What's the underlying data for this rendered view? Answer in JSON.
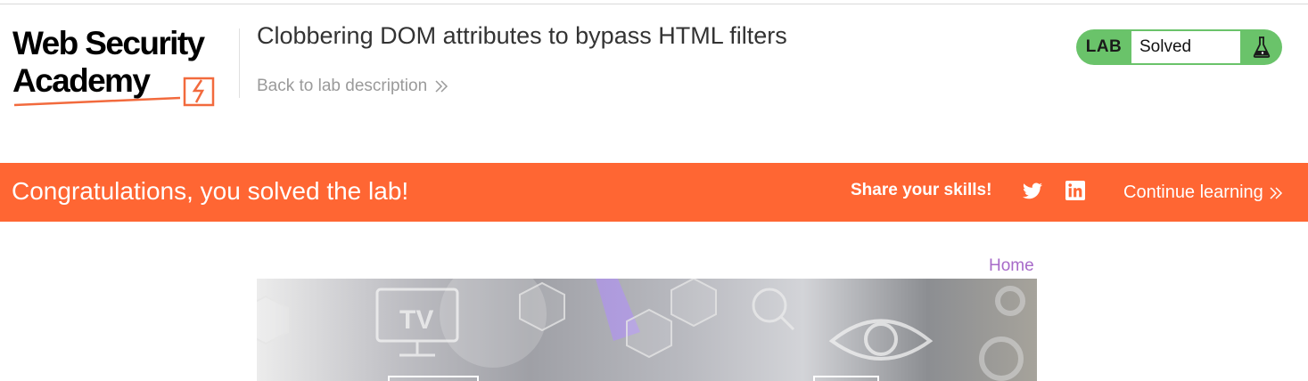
{
  "header": {
    "logo": {
      "line1": "Web Security",
      "line2": "Academy"
    },
    "lab_title": "Clobbering DOM attributes to bypass HTML filters",
    "back_link": "Back to lab description",
    "status": {
      "tag": "LAB",
      "value": "Solved"
    }
  },
  "banner": {
    "message": "Congratulations, you solved the lab!",
    "share_label": "Share your skills!",
    "continue_label": "Continue learning"
  },
  "content": {
    "home_link": "Home",
    "hero_text": "TV"
  },
  "colors": {
    "banner": "#ff6633",
    "status_green": "#6ac36a",
    "home_link": "#a76ac9",
    "logo_accent": "#f26a3d"
  },
  "icons": [
    "chevron-double-right-icon",
    "flask-icon",
    "twitter-icon",
    "linkedin-icon"
  ]
}
